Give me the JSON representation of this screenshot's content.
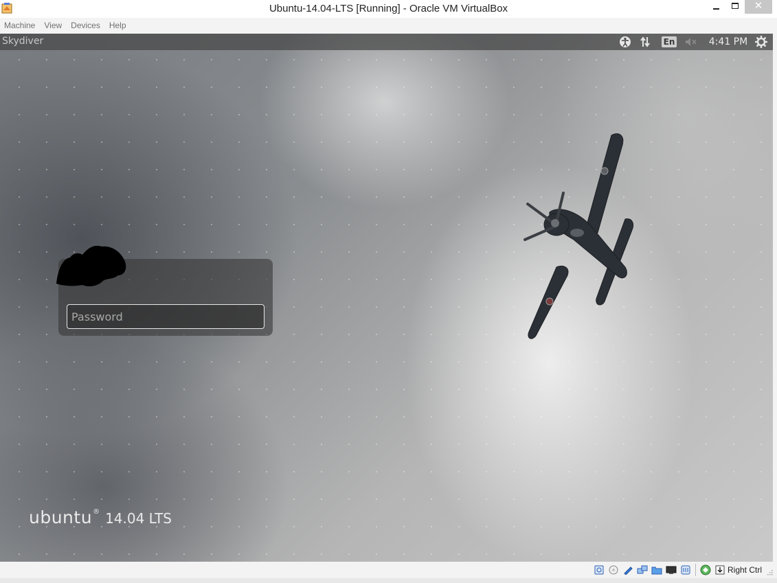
{
  "window": {
    "title": "Ubuntu-14.04-LTS [Running] - Oracle VM VirtualBox",
    "controls": {
      "minimize": "minimize-icon",
      "maximize": "maximize-icon",
      "close": "close-icon"
    }
  },
  "menubar": {
    "items": [
      {
        "label": "Machine"
      },
      {
        "label": "View"
      },
      {
        "label": "Devices"
      },
      {
        "label": "Help"
      }
    ]
  },
  "panel": {
    "hostname": "Skydiver",
    "keyboard_layout": "En",
    "clock": "4:41 PM",
    "icons": [
      "accessibility-icon",
      "network-icon",
      "keyboard-layout-icon",
      "volume-muted-icon",
      "power-gear-icon"
    ]
  },
  "login": {
    "password_placeholder": "Password",
    "password_value": ""
  },
  "branding": {
    "word": "ubuntu",
    "mark": "®",
    "version": "14.04 LTS"
  },
  "statusbar": {
    "icons": [
      "hard-disk-icon",
      "optical-drive-icon",
      "usb-icon",
      "network-adapters-icon",
      "shared-folders-icon",
      "display-icon",
      "video-capture-icon",
      "virtualization-icon",
      "host-key-arrow-icon"
    ],
    "host_key": "Right Ctrl"
  },
  "colors": {
    "panel_bg": "#464646",
    "close_button": "#c7c7c7",
    "input_border": "#e8e8e8"
  }
}
